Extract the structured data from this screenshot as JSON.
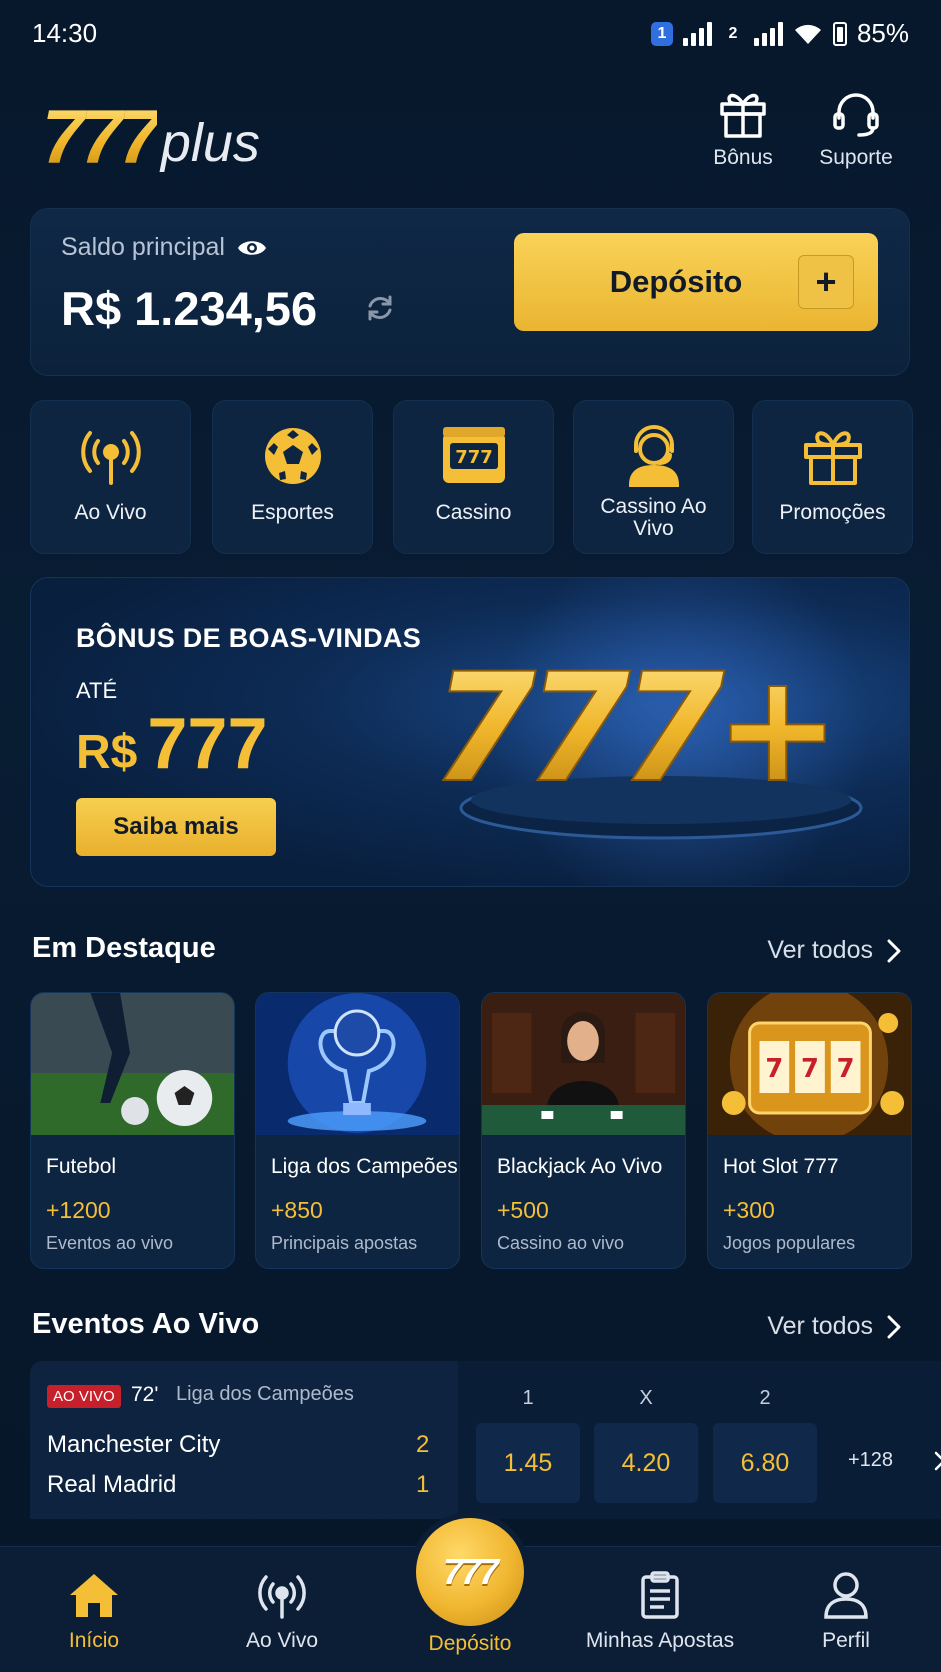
{
  "status_bar": {
    "time": "14:30",
    "sim1": "1",
    "sim2": "2",
    "battery": "85%"
  },
  "header": {
    "logo_main": "777",
    "logo_suffix": "plus",
    "bonus_label": "Bônus",
    "support_label": "Suporte"
  },
  "balance": {
    "label": "Saldo principal",
    "value": "R$ 1.234,56",
    "deposit_label": "Depósito"
  },
  "categories": [
    {
      "label": "Ao Vivo",
      "icon": "broadcast-icon"
    },
    {
      "label": "Esportes",
      "icon": "soccer-ball-icon"
    },
    {
      "label": "Cassino",
      "icon": "slot-machine-icon"
    },
    {
      "label": "Cassino Ao Vivo",
      "icon": "dealer-headset-icon"
    },
    {
      "label": "Promoções",
      "icon": "gift-icon"
    }
  ],
  "banner": {
    "title": "BÔNUS DE BOAS-VINDAS",
    "prefix": "ATÉ",
    "currency": "R$",
    "amount": "777",
    "button": "Saiba mais",
    "art_text": "777+"
  },
  "featured": {
    "title": "Em Destaque",
    "see_all": "Ver todos",
    "items": [
      {
        "name": "Futebol",
        "count": "+1200",
        "sub": "Eventos ao vivo"
      },
      {
        "name": "Liga dos Campeões",
        "count": "+850",
        "sub": "Principais apostas"
      },
      {
        "name": "Blackjack Ao Vivo",
        "count": "+500",
        "sub": "Cassino ao vivo"
      },
      {
        "name": "Hot Slot 777",
        "count": "+300",
        "sub": "Jogos populares"
      }
    ]
  },
  "live_events": {
    "title": "Eventos Ao Vivo",
    "see_all": "Ver todos",
    "event": {
      "badge": "AO VIVO",
      "minute": "72'",
      "league": "Liga dos Campeões",
      "home_team": "Manchester City",
      "away_team": "Real Madrid",
      "home_score": "2",
      "away_score": "1",
      "odds_headers": [
        "1",
        "X",
        "2"
      ],
      "odds": [
        "1.45",
        "4.20",
        "6.80"
      ],
      "more_markets": "+128"
    }
  },
  "bottom_nav": {
    "home": "Início",
    "live": "Ao Vivo",
    "deposit": "Depósito",
    "deposit_badge": "777",
    "bets": "Minhas Apostas",
    "profile": "Perfil"
  },
  "colors": {
    "background": "#07182b",
    "accent_gold": "#f4bf36",
    "card": "#0e2542",
    "live_red": "#c8202a"
  }
}
